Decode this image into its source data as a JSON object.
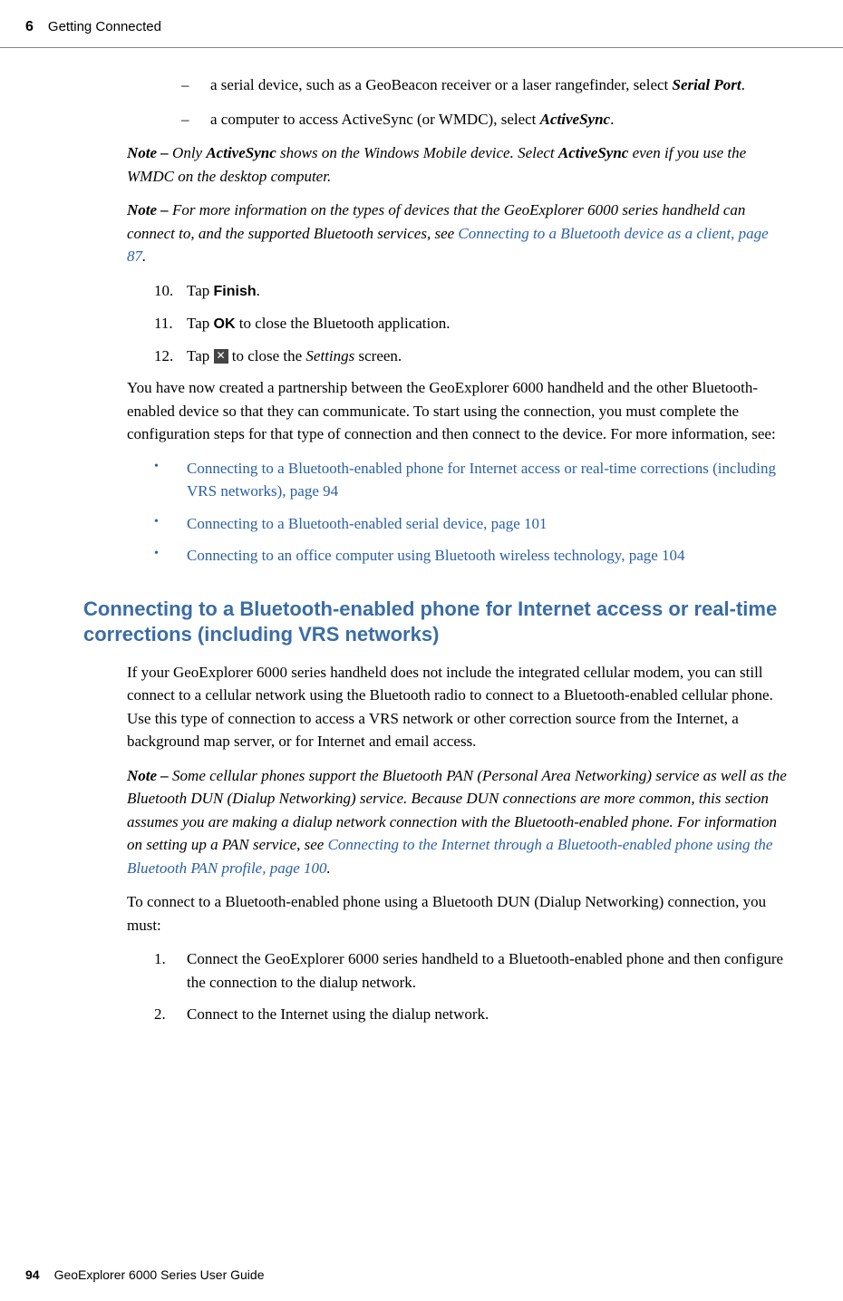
{
  "header": {
    "chapter_num": "6",
    "chapter_title": "Getting Connected"
  },
  "sub_items": [
    {
      "dash": "–",
      "text_before": "a serial device, such as a GeoBeacon receiver or a laser rangefinder, select ",
      "bold": "Serial Port",
      "text_after": "."
    },
    {
      "dash": "–",
      "text_before": "a computer to access ActiveSync (or WMDC), select ",
      "bold": "ActiveSync",
      "text_after": "."
    }
  ],
  "note1": {
    "label": "Note – ",
    "t1": "Only ",
    "b1": "ActiveSync",
    "t2": " shows on the Windows Mobile device. Select ",
    "b2": "ActiveSync",
    "t3": " even if you use the WMDC on the desktop computer."
  },
  "note2": {
    "label": "Note – ",
    "t1": "For more information on the types of devices that the GeoExplorer 6000 series handheld can connect to, and the supported Bluetooth services, see ",
    "link": "Connecting to a Bluetooth device as a client, page 87",
    "t2": "."
  },
  "steps": {
    "s10_num": "10.",
    "s10_t1": "Tap ",
    "s10_b": "Finish",
    "s10_t2": ".",
    "s11_num": "11.",
    "s11_t1": "Tap ",
    "s11_b": "OK",
    "s11_t2": " to close the Bluetooth application.",
    "s12_num": "12.",
    "s12_t1": "Tap ",
    "s12_t2": " to close the ",
    "s12_i": "Settings",
    "s12_t3": " screen."
  },
  "para1": "You have now created a partnership between the GeoExplorer 6000 handheld and the other Bluetooth-enabled device so that they can communicate. To start using the connection, you must complete the configuration steps for that type of connection and then connect to the device. For more information, see:",
  "bullets": [
    "Connecting to a Bluetooth-enabled phone for Internet access or real-time corrections (including VRS networks), page 94",
    "Connecting to a Bluetooth-enabled serial device, page 101",
    "Connecting to an office computer using Bluetooth wireless technology, page 104"
  ],
  "section_heading": "Connecting to a Bluetooth-enabled phone for Internet access or real-time corrections (including VRS networks)",
  "para2": "If your GeoExplorer 6000 series handheld does not include the integrated cellular modem, you can still connect to a cellular network using the Bluetooth radio to connect to a Bluetooth-enabled cellular phone. Use this type of connection to access a VRS network or other correction source from the Internet, a background map server, or for Internet and email access.",
  "note3": {
    "label": "Note – ",
    "t1": "Some cellular phones support the Bluetooth PAN (Personal Area Networking) service as well as the Bluetooth DUN (Dialup Networking) service. Because DUN connections are more common, this section assumes you are making a dialup network connection with the Bluetooth-enabled phone. For information on setting up a PAN service, see ",
    "link": "Connecting to the Internet through a Bluetooth-enabled phone using the Bluetooth PAN profile, page 100",
    "t2": "."
  },
  "para3": "To connect to a Bluetooth-enabled phone using a Bluetooth DUN (Dialup Networking) connection, you must:",
  "steps2": {
    "s1_num": "1.",
    "s1_text": "Connect the GeoExplorer 6000 series handheld to a Bluetooth-enabled phone and then configure the connection to the dialup network.",
    "s2_num": "2.",
    "s2_text": "Connect to the Internet using the dialup network."
  },
  "footer": {
    "page_num": "94",
    "guide_title": "GeoExplorer 6000 Series User Guide"
  }
}
